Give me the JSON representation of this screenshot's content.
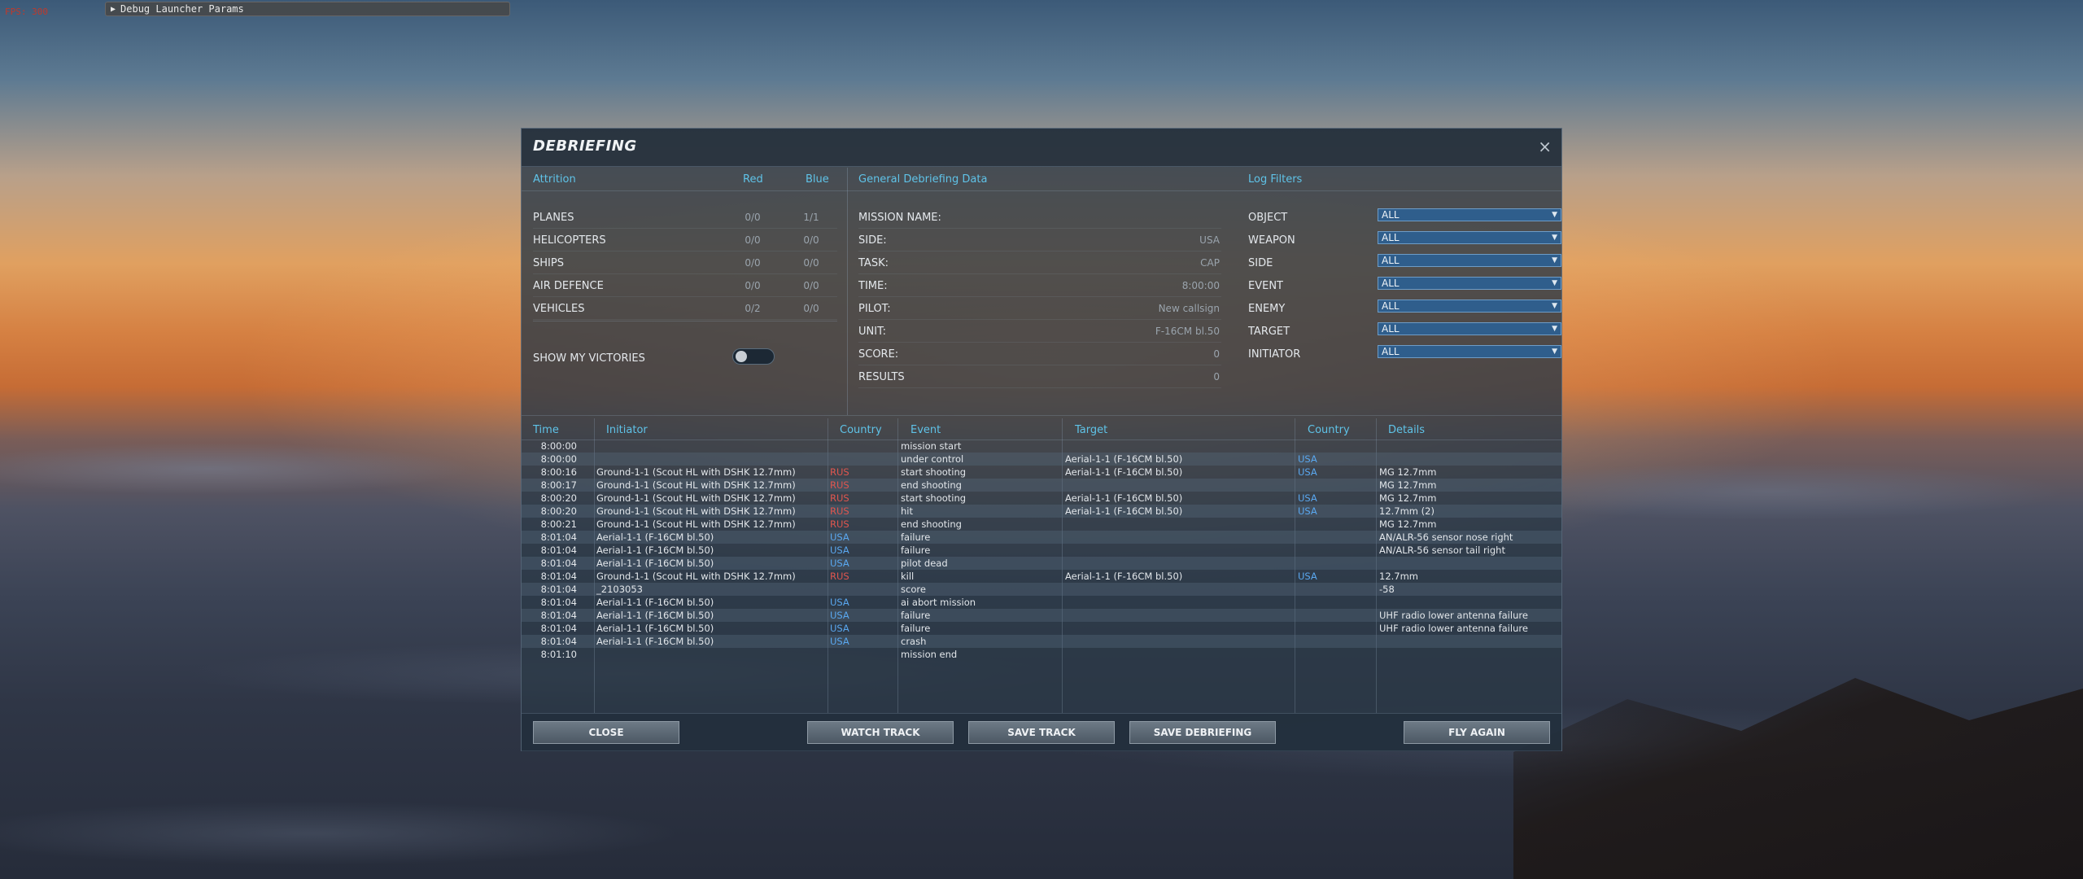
{
  "overlay": {
    "fps_text": "FPS: 300",
    "debug_label": "Debug Launcher Params"
  },
  "dialog": {
    "title": "DEBRIEFING",
    "close_icon": "×"
  },
  "attrition": {
    "title": "Attrition",
    "red_label": "Red",
    "blue_label": "Blue",
    "rows": [
      {
        "label": "PLANES",
        "red": "0/0",
        "blue": "1/1"
      },
      {
        "label": "HELICOPTERS",
        "red": "0/0",
        "blue": "0/0"
      },
      {
        "label": "SHIPS",
        "red": "0/0",
        "blue": "0/0"
      },
      {
        "label": "AIR DEFENCE",
        "red": "0/0",
        "blue": "0/0"
      },
      {
        "label": "VEHICLES",
        "red": "0/2",
        "blue": "0/0"
      }
    ],
    "show_victories_label": "SHOW MY VICTORIES",
    "show_victories_on": false
  },
  "general": {
    "title": "General Debriefing Data",
    "rows": [
      {
        "label": "MISSION NAME:",
        "value": ""
      },
      {
        "label": "SIDE:",
        "value": "USA"
      },
      {
        "label": "TASK:",
        "value": "CAP"
      },
      {
        "label": "TIME:",
        "value": "8:00:00"
      },
      {
        "label": "PILOT:",
        "value": "New callsign"
      },
      {
        "label": "UNIT:",
        "value": "F-16CM bl.50"
      },
      {
        "label": "SCORE:",
        "value": "0"
      },
      {
        "label": "RESULTS",
        "value": "0"
      }
    ]
  },
  "filters": {
    "title": "Log Filters",
    "rows": [
      {
        "label": "OBJECT",
        "value": "ALL"
      },
      {
        "label": "WEAPON",
        "value": "ALL"
      },
      {
        "label": "SIDE",
        "value": "ALL"
      },
      {
        "label": "EVENT",
        "value": "ALL"
      },
      {
        "label": "ENEMY",
        "value": "ALL"
      },
      {
        "label": "TARGET",
        "value": "ALL"
      },
      {
        "label": "INITIATOR",
        "value": "ALL"
      }
    ]
  },
  "log": {
    "headers": {
      "time": "Time",
      "initiator": "Initiator",
      "country": "Country",
      "event": "Event",
      "target": "Target",
      "target_country": "Country",
      "details": "Details"
    },
    "rows": [
      {
        "time": "8:00:00",
        "initiator": "",
        "icountry": "",
        "event": "mission start",
        "target": "",
        "tcountry": "",
        "details": ""
      },
      {
        "time": "8:00:00",
        "initiator": "",
        "icountry": "",
        "event": "under control",
        "target": "Aerial-1-1 (F-16CM bl.50)",
        "tcountry": "USA",
        "details": ""
      },
      {
        "time": "8:00:16",
        "initiator": "Ground-1-1 (Scout HL with DSHK 12.7mm)",
        "icountry": "RUS",
        "event": "start shooting",
        "target": "Aerial-1-1 (F-16CM bl.50)",
        "tcountry": "USA",
        "details": "MG 12.7mm"
      },
      {
        "time": "8:00:17",
        "initiator": "Ground-1-1 (Scout HL with DSHK 12.7mm)",
        "icountry": "RUS",
        "event": "end shooting",
        "target": "",
        "tcountry": "",
        "details": "MG 12.7mm"
      },
      {
        "time": "8:00:20",
        "initiator": "Ground-1-1 (Scout HL with DSHK 12.7mm)",
        "icountry": "RUS",
        "event": "start shooting",
        "target": "Aerial-1-1 (F-16CM bl.50)",
        "tcountry": "USA",
        "details": "MG 12.7mm"
      },
      {
        "time": "8:00:20",
        "initiator": "Ground-1-1 (Scout HL with DSHK 12.7mm)",
        "icountry": "RUS",
        "event": "hit",
        "target": "Aerial-1-1 (F-16CM bl.50)",
        "tcountry": "USA",
        "details": "12.7mm (2)"
      },
      {
        "time": "8:00:21",
        "initiator": "Ground-1-1 (Scout HL with DSHK 12.7mm)",
        "icountry": "RUS",
        "event": "end shooting",
        "target": "",
        "tcountry": "",
        "details": "MG 12.7mm"
      },
      {
        "time": "8:01:04",
        "initiator": "Aerial-1-1 (F-16CM bl.50)",
        "icountry": "USA",
        "event": "failure",
        "target": "",
        "tcountry": "",
        "details": "AN/ALR-56 sensor nose right"
      },
      {
        "time": "8:01:04",
        "initiator": "Aerial-1-1 (F-16CM bl.50)",
        "icountry": "USA",
        "event": "failure",
        "target": "",
        "tcountry": "",
        "details": "AN/ALR-56 sensor tail right"
      },
      {
        "time": "8:01:04",
        "initiator": "Aerial-1-1 (F-16CM bl.50)",
        "icountry": "USA",
        "event": "pilot dead",
        "target": "",
        "tcountry": "",
        "details": ""
      },
      {
        "time": "8:01:04",
        "initiator": "Ground-1-1 (Scout HL with DSHK 12.7mm)",
        "icountry": "RUS",
        "event": "kill",
        "target": "Aerial-1-1 (F-16CM bl.50)",
        "tcountry": "USA",
        "details": "12.7mm"
      },
      {
        "time": "8:01:04",
        "initiator": "_2103053",
        "icountry": "",
        "event": "score",
        "target": "",
        "tcountry": "",
        "details": "-58"
      },
      {
        "time": "8:01:04",
        "initiator": "Aerial-1-1 (F-16CM bl.50)",
        "icountry": "USA",
        "event": "ai abort mission",
        "target": "",
        "tcountry": "",
        "details": ""
      },
      {
        "time": "8:01:04",
        "initiator": "Aerial-1-1 (F-16CM bl.50)",
        "icountry": "USA",
        "event": "failure",
        "target": "",
        "tcountry": "",
        "details": "UHF radio lower antenna failure"
      },
      {
        "time": "8:01:04",
        "initiator": "Aerial-1-1 (F-16CM bl.50)",
        "icountry": "USA",
        "event": "failure",
        "target": "",
        "tcountry": "",
        "details": "UHF radio lower antenna failure"
      },
      {
        "time": "8:01:04",
        "initiator": "Aerial-1-1 (F-16CM bl.50)",
        "icountry": "USA",
        "event": "crash",
        "target": "",
        "tcountry": "",
        "details": ""
      },
      {
        "time": "8:01:10",
        "initiator": "",
        "icountry": "",
        "event": "mission end",
        "target": "",
        "tcountry": "",
        "details": ""
      }
    ]
  },
  "buttons": {
    "close": "CLOSE",
    "watch_track": "WATCH TRACK",
    "save_track": "SAVE TRACK",
    "save_debriefing": "SAVE DEBRIEFING",
    "fly_again": "FLY AGAIN"
  },
  "colors": {
    "accent": "#5fc3e8",
    "rus": "#e0564f",
    "usa": "#5aa8f0"
  }
}
